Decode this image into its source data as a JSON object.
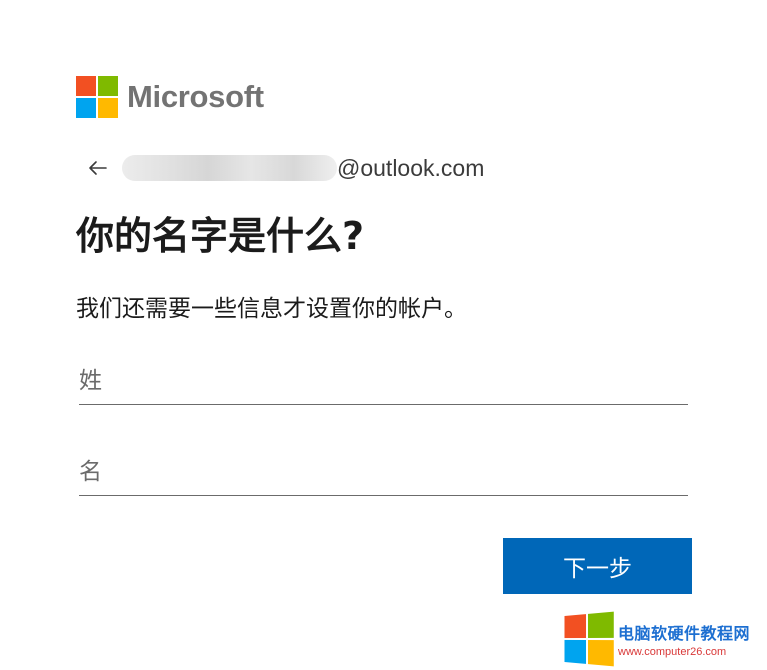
{
  "brand": {
    "name": "Microsoft",
    "colors": {
      "red": "#f25022",
      "green": "#7fba00",
      "blue": "#00a4ef",
      "yellow": "#ffb900"
    }
  },
  "identity": {
    "back_icon": "arrow-left-icon",
    "email_domain": "@outlook.com"
  },
  "page": {
    "title": "你的名字是什么?",
    "subtitle": "我们还需要一些信息才设置你的帐户。"
  },
  "form": {
    "last_name_placeholder": "姓",
    "first_name_placeholder": "名",
    "next_label": "下一步",
    "accent": "#0067b8"
  },
  "watermark": {
    "name": "电脑软硬件教程网",
    "url": "www.computer26.com"
  }
}
